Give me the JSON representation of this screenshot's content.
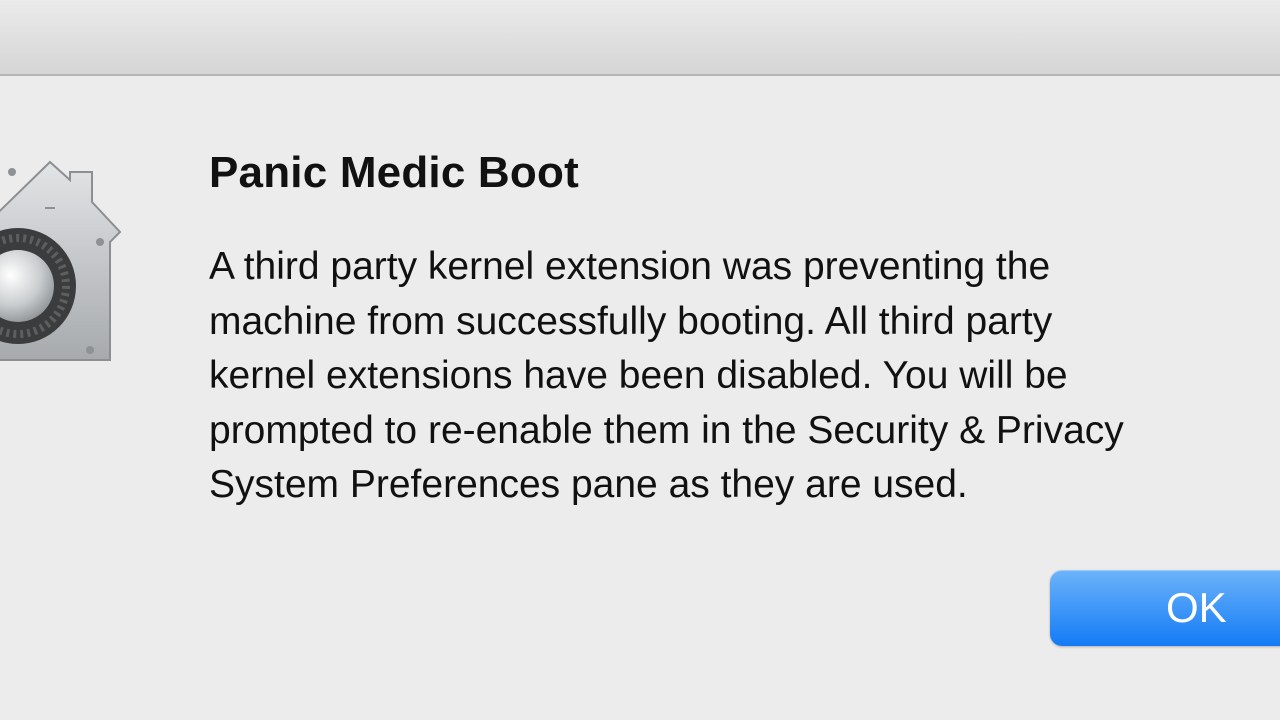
{
  "dialog": {
    "title": "Panic Medic Boot",
    "message_lines": [
      "A third party kernel extension was preventing the",
      "machine from successfully booting.  All third party",
      "kernel extensions have been disabled.  You will be",
      "prompted to re-enable them in the Security & Privacy",
      "System Preferences pane as they are used."
    ],
    "icon": "security-lock-house-icon",
    "ok_label": "OK"
  },
  "colors": {
    "background": "#ececec",
    "button_accent": "#1a7ef5",
    "text": "#111111"
  }
}
